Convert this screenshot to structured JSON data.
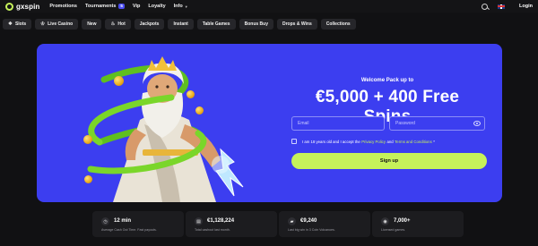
{
  "brand": {
    "logo_text": "gxspin"
  },
  "nav": {
    "items": [
      {
        "label": "Promotions"
      },
      {
        "label": "Tournaments",
        "badge": "5"
      },
      {
        "label": "Vip"
      },
      {
        "label": "Loyalty"
      },
      {
        "label": "Info"
      }
    ],
    "login_label": "Login"
  },
  "categories": [
    {
      "label": "Slots",
      "icon": "slots-icon"
    },
    {
      "label": "Live Casino",
      "icon": "live-casino-icon"
    },
    {
      "label": "New"
    },
    {
      "label": "Hot",
      "icon": "flame-icon"
    },
    {
      "label": "Jackpots"
    },
    {
      "label": "Instant"
    },
    {
      "label": "Table Games"
    },
    {
      "label": "Bonus Buy"
    },
    {
      "label": "Drops & Wins"
    },
    {
      "label": "Collections"
    }
  ],
  "hero": {
    "welcome": "Welcome Pack up to",
    "headline": "€5,000 + 400 Free Spins",
    "email_placeholder": "Email",
    "password_placeholder": "Password",
    "consent_prefix": "I am 18 years old and I accept the",
    "privacy_link": "Privacy Policy",
    "consent_and": "and",
    "terms_link": "Terms and Conditions",
    "consent_required": "*",
    "signup_label": "Sign up"
  },
  "stats": [
    {
      "icon": "clock-icon",
      "value": "12 min",
      "desc": "Average Cash Out Time. Fast payouts."
    },
    {
      "icon": "wallet-icon",
      "value": "€1,128,224",
      "desc": "Total cashout last month."
    },
    {
      "icon": "money-icon",
      "value": "€9,240",
      "desc": "Last big win in 3 Coin Volcanoes."
    },
    {
      "icon": "games-icon",
      "value": "7,000+",
      "desc": "Licensed games."
    }
  ],
  "colors": {
    "accent": "#c6f25a",
    "hero_bg": "#3c3ef0",
    "page_bg": "#111113",
    "badge": "#4a4cf0"
  }
}
